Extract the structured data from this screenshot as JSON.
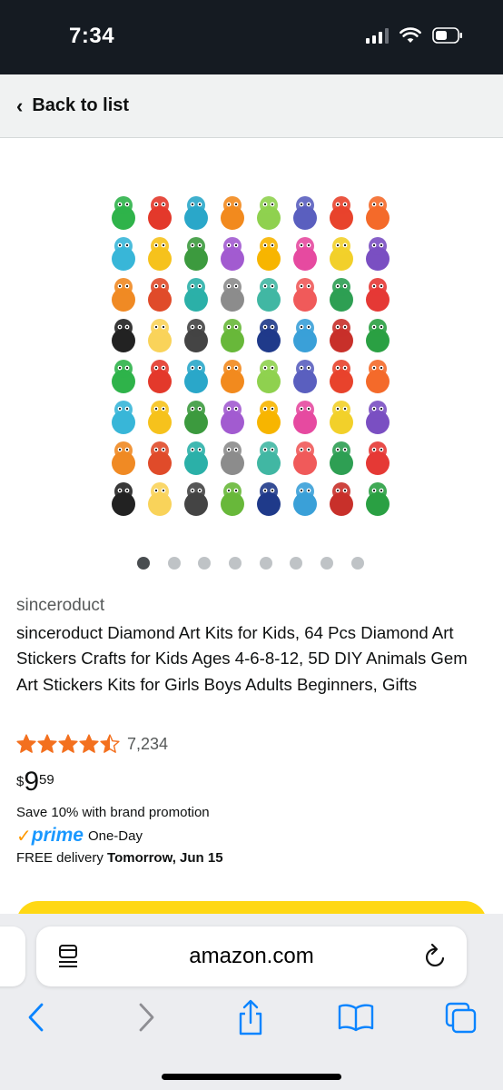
{
  "status_bar": {
    "time": "7:34"
  },
  "header": {
    "back_label": "Back to list"
  },
  "carousel": {
    "dot_count": 8,
    "active_index": 0
  },
  "product": {
    "brand": "sinceroduct",
    "title": "sinceroduct Diamond Art Kits for Kids, 64 Pcs Diamond Art Stickers Crafts for Kids Ages 4-6-8-12, 5D DIY Animals Gem Art Stickers Kits for Girls Boys Adults Beginners, Gifts",
    "rating": 4.5,
    "rating_count": "7,234",
    "price": {
      "symbol": "$",
      "whole": "9",
      "fraction": "59"
    },
    "promotion": "Save 10% with brand promotion",
    "prime": {
      "logo_text": "prime",
      "badge": "One-Day"
    },
    "delivery": {
      "prefix": "FREE delivery",
      "date": "Tomorrow, Jun 15"
    }
  },
  "browser": {
    "url": "amazon.com"
  },
  "colors": {
    "star": "#f3701f",
    "prime_blue": "#1a98ff",
    "prime_check": "#ff9900",
    "buy_button": "#ffd814",
    "ios_blue": "#0a84ff"
  },
  "icons": [
    "back-chevron-icon",
    "reader-icon",
    "reload-icon",
    "back-icon",
    "forward-icon",
    "share-icon",
    "bookmarks-icon",
    "tabs-icon"
  ]
}
